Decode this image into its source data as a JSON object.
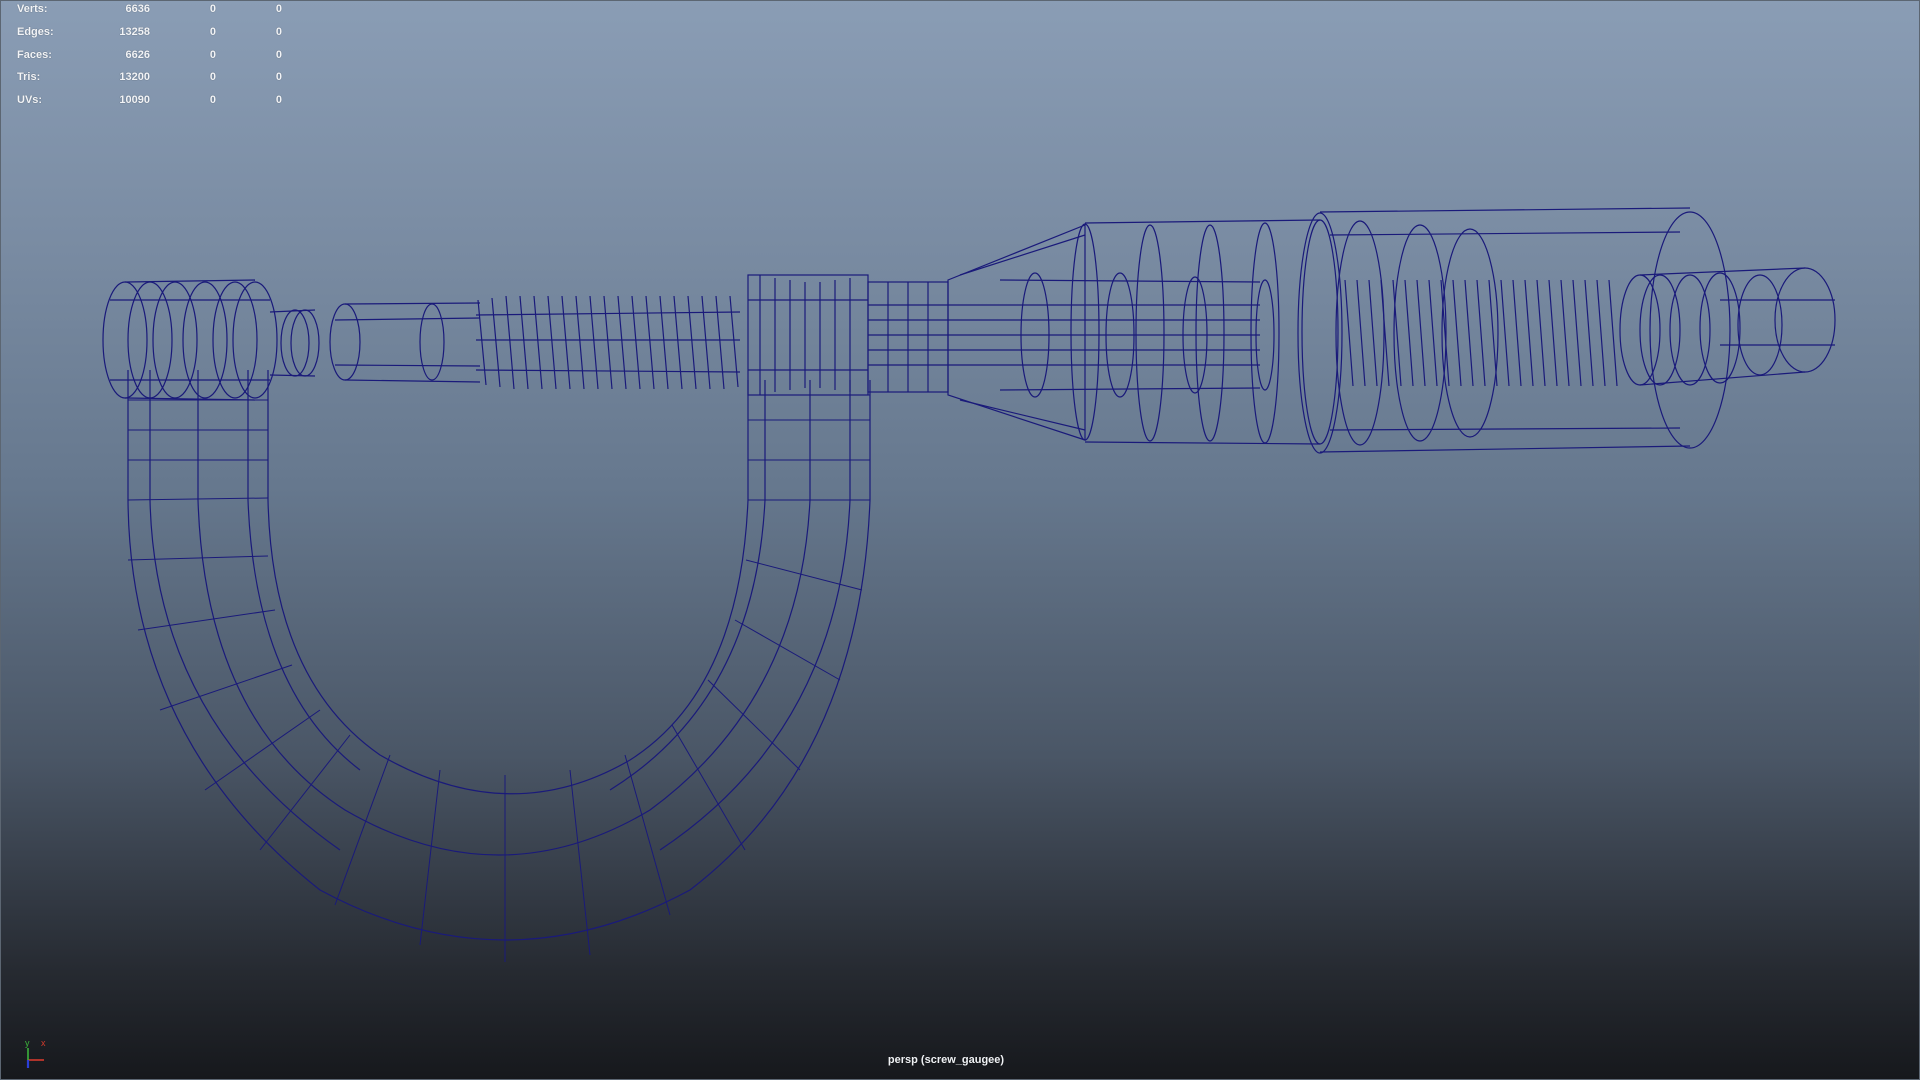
{
  "stats": [
    {
      "label": "Verts:",
      "v1": "6636",
      "v2": "0",
      "v3": "0"
    },
    {
      "label": "Edges:",
      "v1": "13258",
      "v2": "0",
      "v3": "0"
    },
    {
      "label": "Faces:",
      "v1": "6626",
      "v2": "0",
      "v3": "0"
    },
    {
      "label": "Tris:",
      "v1": "13200",
      "v2": "0",
      "v3": "0"
    },
    {
      "label": "UVs:",
      "v1": "10090",
      "v2": "0",
      "v3": "0"
    }
  ],
  "camera_label": "persp (screw_gaugee)",
  "axis": {
    "x": "x",
    "y": "y",
    "z": "z"
  },
  "colors": {
    "wire": "#1a1a7a",
    "axis_x": "#d33a2c",
    "axis_y": "#3bb33b",
    "axis_z": "#2b3fd6"
  }
}
